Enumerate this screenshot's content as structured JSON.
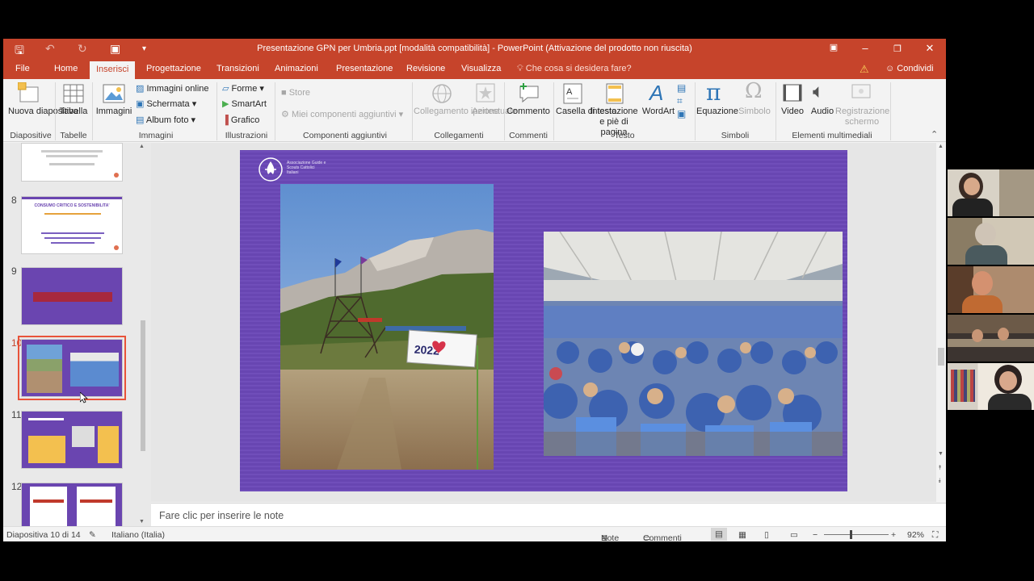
{
  "window": {
    "title": "Presentazione GPN per Umbria.ppt [modalità compatibilità] - PowerPoint (Attivazione del prodotto non riuscita)"
  },
  "tabs": [
    "File",
    "Home",
    "Inserisci",
    "Progettazione",
    "Transizioni",
    "Animazioni",
    "Presentazione",
    "Revisione",
    "Visualizza"
  ],
  "active_tab": "Inserisci",
  "tell_me": "Che cosa si desidera fare?",
  "share": "Condividi",
  "ribbon": {
    "new_slide": "Nuova diapositiva",
    "table": "Tabella",
    "images": "Immagini",
    "online_images": "Immagini online",
    "screenshot": "Schermata",
    "photo_album": "Album foto",
    "shapes": "Forme",
    "smartart": "SmartArt",
    "chart": "Grafico",
    "store": "Store",
    "my_addins": "Miei componenti aggiuntivi",
    "hyperlink": "Collegamento ipertestuale",
    "action": "Azione",
    "comment": "Commento",
    "textbox": "Casella di testo",
    "header_footer": "Intestazione e piè di pagina",
    "wordart": "WordArt",
    "equation": "Equazione",
    "symbol": "Simbolo",
    "video": "Video",
    "audio": "Audio",
    "screen_recording": "Registrazione schermo",
    "groups": {
      "slides": "Diapositive",
      "tables": "Tabelle",
      "images": "Immagini",
      "illustrations": "Illustrazioni",
      "addins": "Componenti aggiuntivi",
      "links": "Collegamenti",
      "comments": "Commenti",
      "text": "Testo",
      "symbols": "Simboli",
      "media": "Elementi multimediali"
    }
  },
  "thumbnails": [
    {
      "num": "8",
      "text": "CONSUMO CRITICO E SOSTENIBILITA'"
    },
    {
      "num": "9",
      "text": ""
    },
    {
      "num": "10",
      "text": ""
    },
    {
      "num": "11",
      "text": ""
    },
    {
      "num": "12",
      "text": ""
    }
  ],
  "slide": {
    "logo_text": "Associazione Guide e Scouts Cattolici Italiani",
    "banner_text": "2022"
  },
  "notes_placeholder": "Fare clic per inserire le note",
  "status": {
    "slide_info": "Diapositiva 10 di 14",
    "language": "Italiano (Italia)",
    "notes": "Note",
    "comments": "Commenti",
    "zoom": "92%"
  },
  "colors": {
    "accent": "#c6442b",
    "slide_bg": "#6b48b8"
  }
}
